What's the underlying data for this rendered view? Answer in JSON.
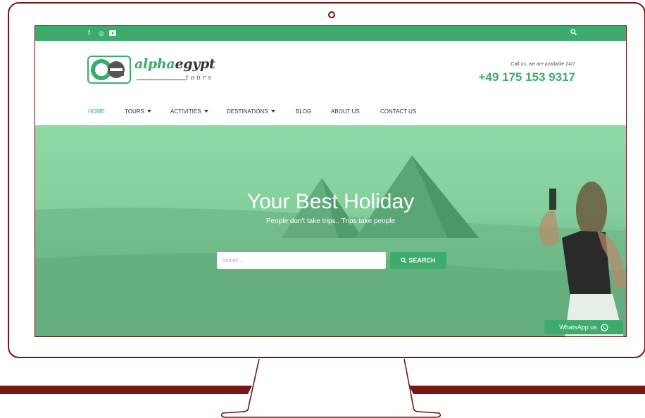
{
  "topbar": {
    "social": [
      {
        "icon": "facebook-icon",
        "glyph": "f"
      },
      {
        "icon": "instagram-icon",
        "glyph": "◎"
      },
      {
        "icon": "youtube-icon",
        "glyph": "▶"
      }
    ],
    "search_icon": "search-icon"
  },
  "logo": {
    "main": "alpha",
    "main2": "egypt",
    "sub": "tours",
    "icon": "logo-icon"
  },
  "contact": {
    "call_text": "Call us, we are available 24/7",
    "phone": "+49 175 153 9317"
  },
  "nav": {
    "items": [
      {
        "label": "HOME",
        "active": true,
        "dropdown": false
      },
      {
        "label": "TOURS",
        "active": false,
        "dropdown": true
      },
      {
        "label": "ACTIVITIES",
        "active": false,
        "dropdown": true
      },
      {
        "label": "DESTINATIONS",
        "active": false,
        "dropdown": true
      },
      {
        "label": "BLOG",
        "active": false,
        "dropdown": false
      },
      {
        "label": "ABOUT US",
        "active": false,
        "dropdown": false
      },
      {
        "label": "CONTACT US",
        "active": false,
        "dropdown": false
      }
    ]
  },
  "hero": {
    "title": "Your Best Holiday",
    "subtitle": "People don't take trips.. Trips take people",
    "search_placeholder": "Search ...",
    "search_button": "SEARCH"
  },
  "whatsapp": {
    "label": "WhatsApp us",
    "icon": "whatsapp-icon"
  },
  "colors": {
    "brand_green": "#3dab6c",
    "frame": "#7a1518"
  }
}
